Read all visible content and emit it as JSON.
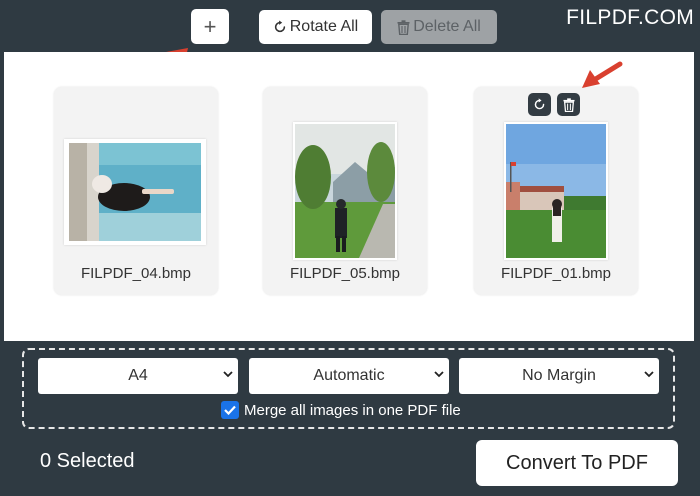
{
  "toolbar": {
    "add_label": "+",
    "rotate_all_label": "Rotate All",
    "delete_all_label": "Delete All",
    "rotate_icon": "rotate-icon",
    "trash_icon": "trash-icon"
  },
  "brand": {
    "name": "FILPDF.COM"
  },
  "files": [
    {
      "name": "FILPDF_04.bmp"
    },
    {
      "name": "FILPDF_05.bmp"
    },
    {
      "name": "FILPDF_01.bmp"
    }
  ],
  "options": {
    "page_size": "A4",
    "orientation": "Automatic",
    "margin": "No Margin",
    "merge_checked": true,
    "merge_label": "Merge all images in one PDF file"
  },
  "footer": {
    "selected_text": "0 Selected",
    "convert_label": "Convert To PDF"
  },
  "colors": {
    "background": "#2f3a42",
    "annotation_arrow": "#d9402f",
    "checkbox": "#1a73e8"
  }
}
